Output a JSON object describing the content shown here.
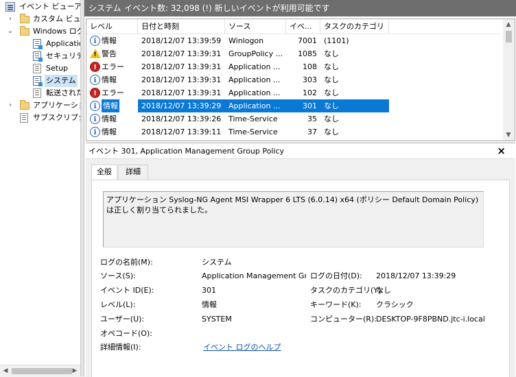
{
  "tree": {
    "items": [
      {
        "label": "イベント ビューアー (",
        "icon": "event-viewer-icon",
        "chevron": ""
      },
      {
        "label": "カスタム ビュー",
        "icon": "folder-icon",
        "chevron": "›"
      },
      {
        "label": "Windows ログ",
        "icon": "folder-icon",
        "chevron": "⌄"
      },
      {
        "label": "Applicatio",
        "icon": "log-icon"
      },
      {
        "label": "セキュリティ",
        "icon": "log-icon"
      },
      {
        "label": "Setup",
        "icon": "log-icon"
      },
      {
        "label": "システム",
        "icon": "log-icon"
      },
      {
        "label": "転送された",
        "icon": "log-icon"
      },
      {
        "label": "アプリケーション",
        "icon": "folder-icon",
        "chevron": "›"
      },
      {
        "label": "サブスクリプショ",
        "icon": "subscription-icon"
      }
    ]
  },
  "titlebar": {
    "log_name": "システム",
    "count_text": "イベント数: 32,098 (!) 新しいイベントが利用可能です"
  },
  "columns": [
    "レベル",
    "日付と時刻",
    "ソース",
    "イベ...",
    "タスクのカテゴリ"
  ],
  "events": [
    {
      "level": "情報",
      "icon": "info-icon",
      "datetime": "2018/12/07 13:39:59",
      "source": "Winlogon",
      "event_id": "7001",
      "category": "(1101)"
    },
    {
      "level": "警告",
      "icon": "warning-icon",
      "datetime": "2018/12/07 13:39:31",
      "source": "GroupPolicy ...",
      "event_id": "1085",
      "category": "なし"
    },
    {
      "level": "エラー",
      "icon": "error-icon",
      "datetime": "2018/12/07 13:39:31",
      "source": "Application ...",
      "event_id": "108",
      "category": "なし"
    },
    {
      "level": "情報",
      "icon": "info-icon",
      "datetime": "2018/12/07 13:39:31",
      "source": "Application ...",
      "event_id": "303",
      "category": "なし"
    },
    {
      "level": "エラー",
      "icon": "error-icon",
      "datetime": "2018/12/07 13:39:31",
      "source": "Application ...",
      "event_id": "102",
      "category": "なし"
    },
    {
      "level": "情報",
      "icon": "info-icon",
      "datetime": "2018/12/07 13:39:29",
      "source": "Application ...",
      "event_id": "301",
      "category": "なし"
    },
    {
      "level": "情報",
      "icon": "info-icon",
      "datetime": "2018/12/07 13:39:26",
      "source": "Time-Service",
      "event_id": "35",
      "category": "なし"
    },
    {
      "level": "情報",
      "icon": "info-icon",
      "datetime": "2018/12/07 13:39:11",
      "source": "Time-Service",
      "event_id": "37",
      "category": "なし"
    }
  ],
  "detail": {
    "header": "イベント 301, Application Management Group Policy",
    "close_glyph": "×",
    "tabs": [
      "全般",
      "詳細"
    ],
    "message": "アプリケーション Syslog-NG Agent MSI Wrapper 6 LTS (6.0.14) x64 (ポリシー Default Domain Policy) は正しく割り当てられました。",
    "fields": {
      "log_name_label": "ログの名前(M):",
      "log_name_value": "システム",
      "source_label": "ソース(S):",
      "source_value": "Application Management Group Policy",
      "logged_label": "ログの日付(D):",
      "logged_value": "2018/12/07 13:39:29",
      "event_id_label": "イベント ID(E):",
      "event_id_value": "301",
      "task_label": "タスクのカテゴリ(Y):",
      "task_value": "なし",
      "level_label": "レベル(L):",
      "level_value": "情報",
      "keywords_label": "キーワード(K):",
      "keywords_value": "クラシック",
      "user_label": "ユーザー(U):",
      "user_value": "SYSTEM",
      "computer_label": "コンピューター(R):",
      "computer_value": "DESKTOP-9F8PBND.jtc-i.local",
      "opcode_label": "オペコード(O):",
      "opcode_value": "",
      "more_info_label": "詳細情報(I):",
      "more_info_link": "イベント ログのヘルプ"
    }
  },
  "selected_event_index": 5
}
